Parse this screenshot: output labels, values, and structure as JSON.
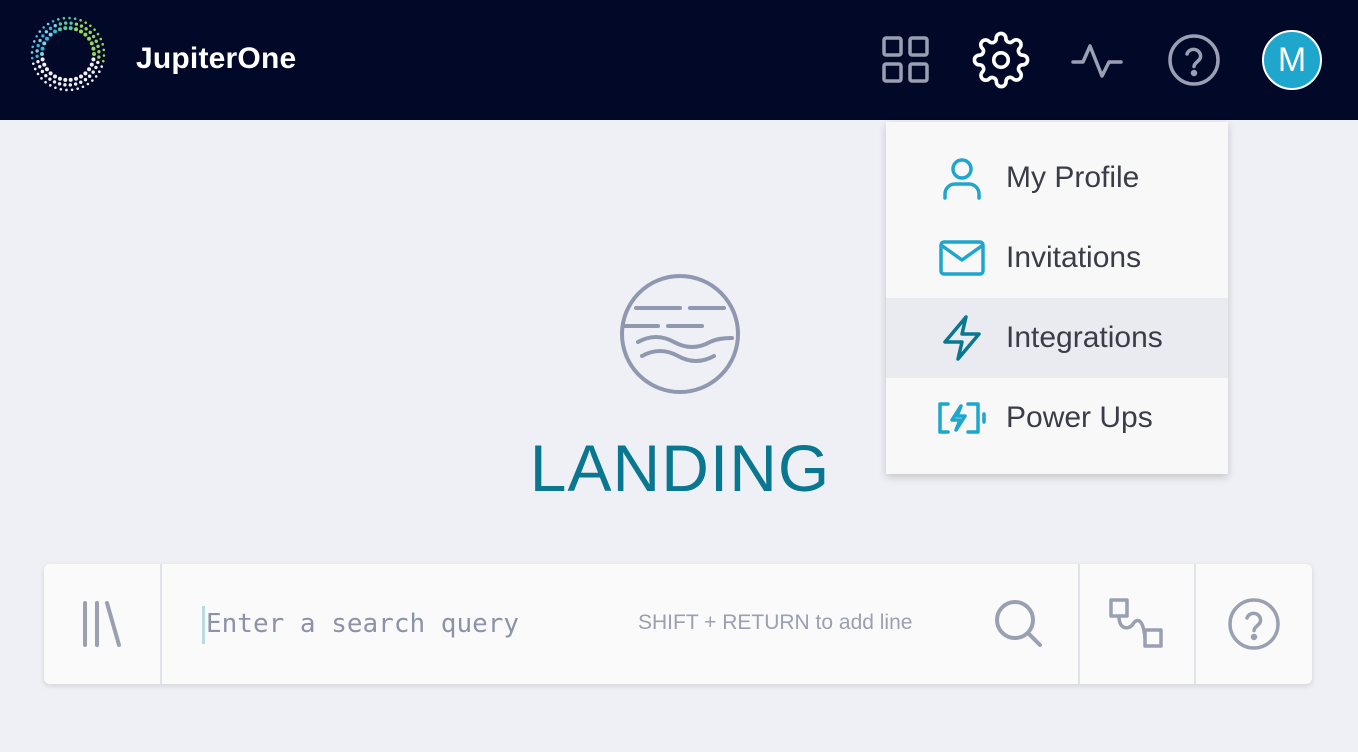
{
  "header": {
    "brand": "JupiterOne",
    "icons": [
      "apps-grid-icon",
      "gear-icon",
      "activity-pulse-icon",
      "help-circle-icon"
    ],
    "avatar_initial": "M",
    "avatar_color": "#1ea6cc",
    "background_color": "#020828"
  },
  "landing": {
    "title": "LANDING",
    "title_color": "#0a7791",
    "icon": "planet-icon"
  },
  "search": {
    "placeholder": "Enter a search query",
    "value": "",
    "hint": "SHIFT + RETURN to add line",
    "icons": [
      "library-icon",
      "search-icon",
      "graph-view-icon",
      "help-circle-icon"
    ]
  },
  "settings_menu": {
    "items": [
      {
        "label": "My Profile",
        "icon": "user-icon"
      },
      {
        "label": "Invitations",
        "icon": "envelope-icon"
      },
      {
        "label": "Integrations",
        "icon": "lightning-bolt-icon",
        "highlighted": true
      },
      {
        "label": "Power Ups",
        "icon": "battery-charging-icon"
      }
    ],
    "accent_color": "#1ea6cc"
  }
}
